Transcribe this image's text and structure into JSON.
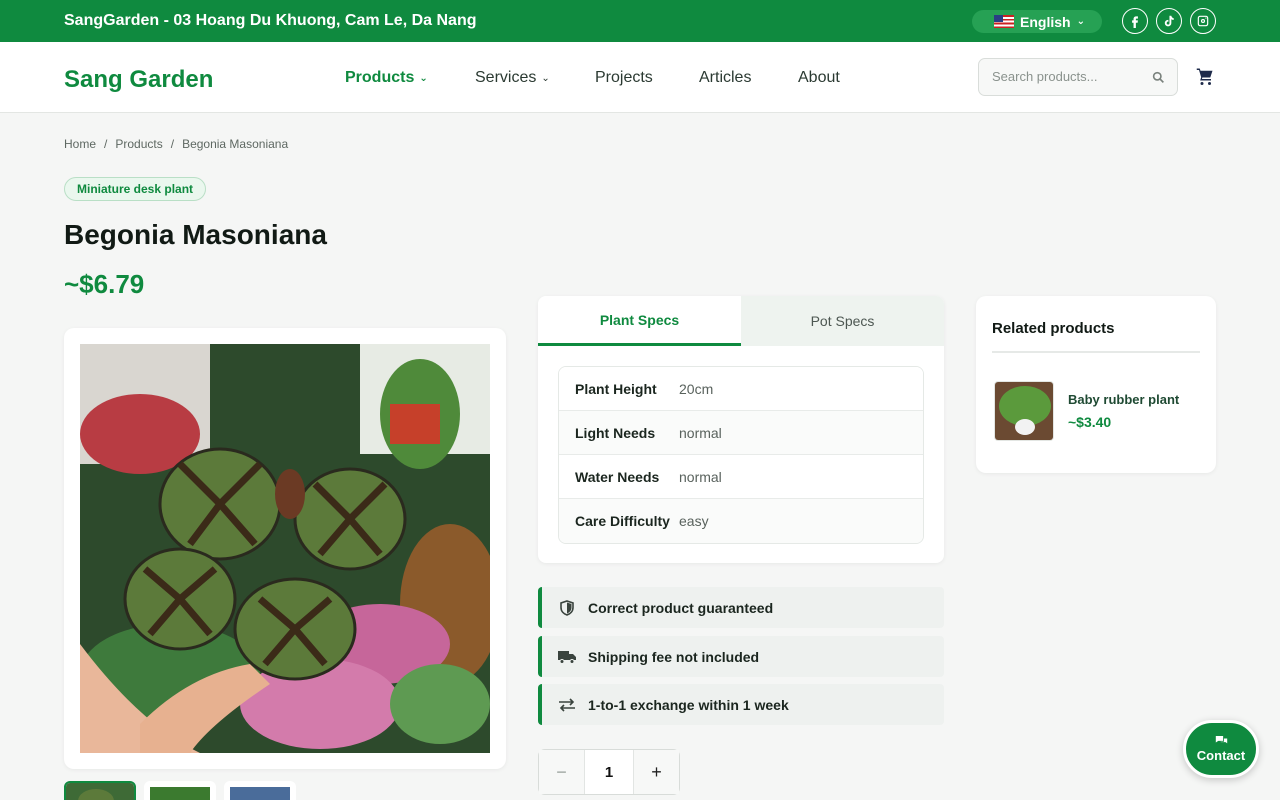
{
  "topbar": {
    "address": "SangGarden - 03 Hoang Du Khuong, Cam Le, Da Nang",
    "language": "English",
    "social": [
      "facebook-icon",
      "tiktok-icon",
      "instagram-icon"
    ]
  },
  "nav": {
    "logo": "Sang Garden",
    "items": [
      {
        "label": "Products",
        "active": true,
        "dropdown": true
      },
      {
        "label": "Services",
        "active": false,
        "dropdown": true
      },
      {
        "label": "Projects",
        "active": false,
        "dropdown": false
      },
      {
        "label": "Articles",
        "active": false,
        "dropdown": false
      },
      {
        "label": "About",
        "active": false,
        "dropdown": false
      }
    ],
    "search_placeholder": "Search products..."
  },
  "breadcrumb": [
    "Home",
    "Products",
    "Begonia Masoniana"
  ],
  "product": {
    "category": "Miniature desk plant",
    "title": "Begonia Masoniana",
    "price": "~$6.79"
  },
  "specs": {
    "tabs": [
      "Plant Specs",
      "Pot Specs"
    ],
    "rows": [
      {
        "label": "Plant Height",
        "value": "20cm"
      },
      {
        "label": "Light Needs",
        "value": "normal"
      },
      {
        "label": "Water Needs",
        "value": "normal"
      },
      {
        "label": "Care Difficulty",
        "value": "easy"
      }
    ]
  },
  "guarantees": [
    {
      "icon": "shield-icon",
      "text": "Correct product guaranteed"
    },
    {
      "icon": "truck-icon",
      "text": "Shipping fee not included"
    },
    {
      "icon": "exchange-icon",
      "text": "1-to-1 exchange within 1 week"
    }
  ],
  "quantity": {
    "value": "1",
    "minus": "−",
    "plus": "+"
  },
  "related": {
    "title": "Related products",
    "items": [
      {
        "name": "Baby rubber plant",
        "price": "~$3.40"
      }
    ]
  },
  "contact_label": "Contact",
  "colors": {
    "brand": "#0f8a3f"
  }
}
